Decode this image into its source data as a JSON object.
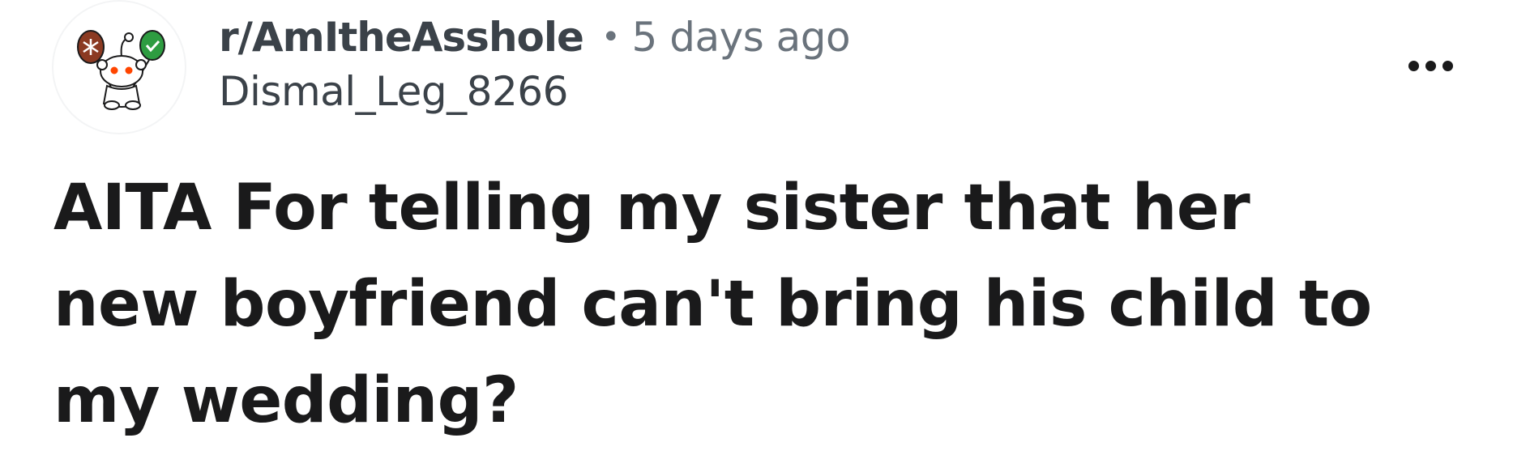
{
  "post": {
    "subreddit": "r/AmItheAsshole",
    "separator": "•",
    "time_ago": "5 days ago",
    "author": "Dismal_Leg_8266",
    "title": "AITA For telling my sister that her new boyfriend can't bring his child to my wedding?"
  },
  "icons": {
    "avatar": "snoo-avatar-with-balloons-icon",
    "more": "more-options-icon"
  },
  "colors": {
    "subreddit_text": "#3b4249",
    "meta_text": "#6a737c",
    "title_text": "#1a1a1b",
    "balloon_left": "#8b3a22",
    "balloon_right": "#2e9c41"
  }
}
